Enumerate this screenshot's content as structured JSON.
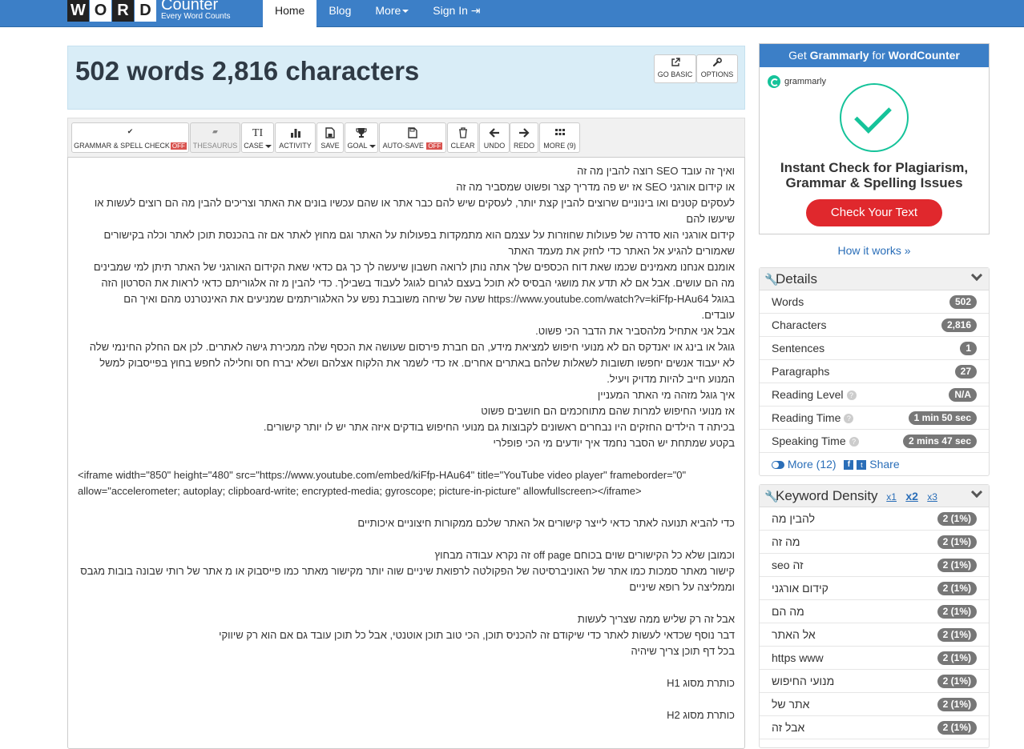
{
  "logo": {
    "letters": [
      "W",
      "O",
      "R",
      "D"
    ],
    "counter": "Counter",
    "tagline": "Every Word Counts"
  },
  "nav": {
    "home": "Home",
    "blog": "Blog",
    "more": "More",
    "signin": "Sign In"
  },
  "count": {
    "title": "502 words 2,816 characters"
  },
  "header_buttons": {
    "go_basic": "GO BASIC",
    "options": "OPTIONS"
  },
  "toolbar": {
    "grammar": "GRAMMAR & SPELL CHECK",
    "grammar_state": "OFF",
    "thesaurus": "THESAURUS",
    "case": "CASE",
    "activity": "ACTIVITY",
    "save": "SAVE",
    "goal": "GOAL",
    "autosave": "AUTO-SAVE",
    "autosave_state": "OFF",
    "clear": "CLEAR",
    "undo": "UNDO",
    "redo": "REDO",
    "more": "MORE (9)"
  },
  "editor_lines": [
    {
      "t": "ואיך זה עובד SEO רוצה להבין מה זה",
      "d": "rtl"
    },
    {
      "t": "או קידום אורגני SEO אז יש פה מדריך קצר ופשוט שמסביר מה זה",
      "d": "rtl"
    },
    {
      "t": "לעסקים קטנים ואו בינוניים שרוצים להבין קצת יותר, לעסקים שיש להם כבר אתר או שהם עכשיו בונים את האתר וצריכים להבין מה הם רוצים לעשות או",
      "d": "rtl"
    },
    {
      "t": "שיעשו להם",
      "d": "rtl"
    },
    {
      "t": "קידום אורגני הוא סדרה של פעולות שחוזרות על עצמם הוא מתמקדות בפעולות על האתר וגם מחוץ לאתר אם זה בהכנסת תוכן לאתר וכלה בקישורים",
      "d": "rtl"
    },
    {
      "t": "שאמורים להגיע אל האתר כדי לחזק את מעמד האתר",
      "d": "rtl"
    },
    {
      "t": "אומנם אנחנו מאמינים שכמו שאת דוח הכספים שלך אתה נותן לרואה חשבון שיעשה לך כך גם כדאי שאת הקידום האורגני של האתר תיתן למי שמבינים",
      "d": "rtl"
    },
    {
      "t": "מה הם עושים. אבל אם לא תדע את מושגי הבסיס לא תוכל בעצם לגרום לגוגל לעבוד בשבילך. כדי להבין מ זה אלגוריתם כדאי לראות את הסרטון הזה",
      "d": "rtl"
    },
    {
      "t": "בגוגל https://www.youtube.com/watch?v=kiFfp-HAu64 שעה של שיחה משובבת נפש על האלגוריתמים שמניעים את האינטרנט מהם ואיך הם",
      "d": "rtl"
    },
    {
      "t": "עובדים.",
      "d": "rtl"
    },
    {
      "t": "אבל אני אתחיל מלהסביר את הדבר הכי פשוט.",
      "d": "rtl"
    },
    {
      "t": "גוגל או בינג או יאנדקס הם לא מנועי חיפוש למציאת מידע, הם חברת פירסום שעושה את הכסף שלה ממכירת גישה לאתרים. לכן אם החלק החינמי שלה",
      "d": "rtl"
    },
    {
      "t": "לא יעבוד אנשים יחפשו תשובות לשאלות שלהם באתרים אחרים. אז כדי לשמר את הלקוח אצלהם ושלא יברח חס וחלילה לחפש בחוץ בפייסבוק למשל",
      "d": "rtl"
    },
    {
      "t": "המנוע חייב להיות מדויק ויעיל.",
      "d": "rtl"
    },
    {
      "t": "איך גוגל מזהה מי האתר המעניין",
      "d": "rtl"
    },
    {
      "t": "אז מנועי החיפוש למרות שהם מתוחכמים הם חושבים פשוט",
      "d": "rtl"
    },
    {
      "t": "בכיתה ד הילדים החזקים היו נבחרים ראשונים לקבוצות גם מנועי החיפוש בודקים איזה אתר יש לו יותר קישורים.",
      "d": "rtl"
    },
    {
      "t": "בקטע שמתחת יש הסבר נחמד איך יודעים מי הכי פופלרי",
      "d": "rtl"
    },
    {
      "t": "",
      "d": "rtl"
    },
    {
      "t": "<iframe width=\"850\" height=\"480\" src=\"https://www.youtube.com/embed/kiFfp-HAu64\" title=\"YouTube video player\" frameborder=\"0\"",
      "d": "ltr"
    },
    {
      "t": "allow=\"accelerometer; autoplay; clipboard-write; encrypted-media; gyroscope; picture-in-picture\" allowfullscreen></iframe>",
      "d": "ltr"
    },
    {
      "t": "",
      "d": "rtl"
    },
    {
      "t": "כדי להביא תנועה לאתר כדאי לייצר קישורים אל האתר שלכם ממקורות חיצוניים איכותיים",
      "d": "rtl"
    },
    {
      "t": "",
      "d": "rtl"
    },
    {
      "t": "וכמובן שלא כל הקישורים שוים בכוחם off page זה נקרא עבודה מבחוץ",
      "d": "rtl"
    },
    {
      "t": "קישור מאתר סמכות כמו אתר של האוניברסיטה של הפקולטה לרפואת שיניים שוה יותר מקישור מאתר כמו פייסבוק או מ אתר של רותי שבונה בובות מגבס",
      "d": "rtl"
    },
    {
      "t": "וממליצה על רופא שיניים",
      "d": "rtl"
    },
    {
      "t": "",
      "d": "rtl"
    },
    {
      "t": "אבל זה רק שליש ממה שצריך לעשות",
      "d": "rtl"
    },
    {
      "t": "דבר נוסף שכדאי לעשות לאתר כדי שיקודם זה להכניס תוכן, הכי טוב תוכן אוטנטי, אבל כל תוכן עובד גם אם הוא רק שיווקי",
      "d": "rtl"
    },
    {
      "t": "בכל דף תוכן צריך שיהיה",
      "d": "rtl"
    },
    {
      "t": "",
      "d": "rtl"
    },
    {
      "t": "כותרת מסוג H1",
      "d": "rtl"
    },
    {
      "t": "",
      "d": "rtl"
    },
    {
      "t": "כותרת מסוג H2",
      "d": "rtl"
    }
  ],
  "ad": {
    "head_prefix": "Get",
    "head_brand": "Grammarly",
    "head_mid": "for",
    "head_site": "WordCounter",
    "logo_text": "grammarly",
    "tagline_1": "Instant Check for Plagiarism,",
    "tagline_2": "Grammar & Spelling Issues",
    "cta": "Check Your Text",
    "how": "How it works »"
  },
  "details": {
    "title": "Details",
    "rows": [
      {
        "label": "Words",
        "value": "502",
        "help": false
      },
      {
        "label": "Characters",
        "value": "2,816",
        "help": false
      },
      {
        "label": "Sentences",
        "value": "1",
        "help": false
      },
      {
        "label": "Paragraphs",
        "value": "27",
        "help": false
      },
      {
        "label": "Reading Level",
        "value": "N/A",
        "help": true
      },
      {
        "label": "Reading Time",
        "value": "1 min 50 sec",
        "help": true
      },
      {
        "label": "Speaking Time",
        "value": "2 mins 47 sec",
        "help": true
      }
    ],
    "more": "More (12)",
    "share": "Share"
  },
  "keyword_density": {
    "title": "Keyword Density",
    "x1": "x1",
    "x2": "x2",
    "x3": "x3",
    "rows": [
      {
        "label": "להבין מה",
        "value": "2 (1%)"
      },
      {
        "label": "מה זה",
        "value": "2 (1%)"
      },
      {
        "label": "seo זה",
        "value": "2 (1%)"
      },
      {
        "label": "קידום אורגני",
        "value": "2 (1%)"
      },
      {
        "label": "מה הם",
        "value": "2 (1%)"
      },
      {
        "label": "אל האתר",
        "value": "2 (1%)"
      },
      {
        "label": "https www",
        "value": "2 (1%)"
      },
      {
        "label": "מנועי החיפוש",
        "value": "2 (1%)"
      },
      {
        "label": "אתר של",
        "value": "2 (1%)"
      },
      {
        "label": "אבל זה",
        "value": "2 (1%)"
      }
    ]
  },
  "colors": {
    "nav": "#3c7fc7",
    "count_bg": "#d9edf7",
    "off": "#d9534f",
    "grammarly": "#15c39a",
    "cta": "#e0282d",
    "badge": "#777777",
    "link": "#2a6eb8"
  }
}
